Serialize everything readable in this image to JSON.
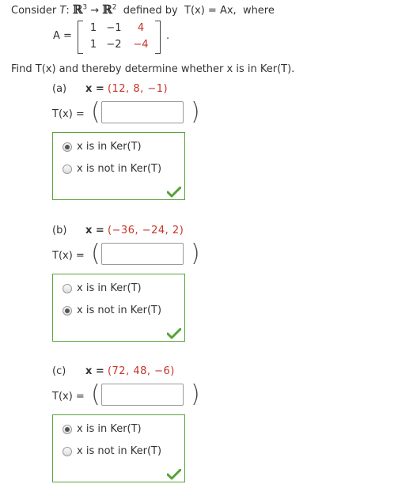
{
  "problem": {
    "consider": "Consider",
    "T": "T",
    "colon": ":",
    "domain": "ℝ",
    "domain_exp": "3",
    "arrow": "→",
    "codomain": "ℝ",
    "codomain_exp": "2",
    "defined_by": "defined by",
    "Tx_eq": "T(x) = Ax,",
    "where": "where",
    "A_eq": "A =",
    "matrix": {
      "row1": [
        "1",
        "−1",
        "4"
      ],
      "row2": [
        "1",
        "−2",
        "−4"
      ]
    },
    "matrix_period": ".",
    "instruction": "Find T(x) and thereby determine whether x is in Ker(T)."
  },
  "parts": [
    {
      "label": "(a)",
      "x_label": "x =",
      "x_value": "(12, 8, −1)",
      "tx_label": "T(x) =",
      "answer_value": "",
      "options": [
        "x is in Ker(T)",
        "x is not in Ker(T)"
      ],
      "selected_index": 0,
      "correct_icon": "checkmark-icon"
    },
    {
      "label": "(b)",
      "x_label": "x =",
      "x_value": "(−36, −24, 2)",
      "tx_label": "T(x) =",
      "answer_value": "",
      "options": [
        "x is in Ker(T)",
        "x is not in Ker(T)"
      ],
      "selected_index": 1,
      "correct_icon": "checkmark-icon"
    },
    {
      "label": "(c)",
      "x_label": "x =",
      "x_value": "(72, 48, −6)",
      "tx_label": "T(x) =",
      "answer_value": "",
      "options": [
        "x is in Ker(T)",
        "x is not in Ker(T)"
      ],
      "selected_index": 0,
      "correct_icon": "checkmark-icon"
    }
  ],
  "colors": {
    "highlight_red": "#c83227",
    "box_green": "#5aa33b",
    "check_green": "#52a436"
  }
}
